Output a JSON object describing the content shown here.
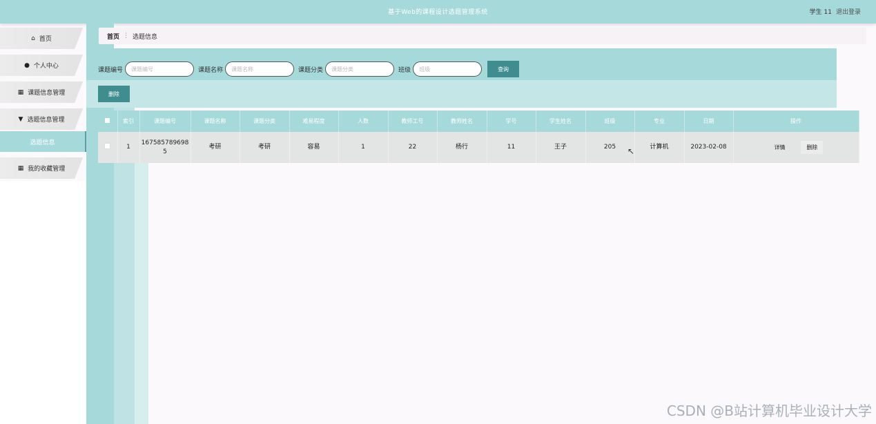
{
  "header": {
    "title": "基于Web的课程设计选题管理系统",
    "user": "学生 11",
    "logout": "退出登录"
  },
  "sidebar": {
    "items": [
      {
        "label": "首页",
        "icon": "home-icon"
      },
      {
        "label": "个人中心",
        "icon": "user-icon"
      },
      {
        "label": "课题信息管理",
        "icon": "grid-icon"
      },
      {
        "label": "选题信息管理",
        "icon": "pin-icon"
      },
      {
        "label": "选题信息",
        "active": true
      },
      {
        "label": "我的收藏管理",
        "icon": "grid-icon"
      }
    ]
  },
  "breadcrumb": {
    "home": "首页",
    "current": "选题信息"
  },
  "search": {
    "fields": [
      {
        "label": "课题编号",
        "placeholder": "课题编号",
        "value": ""
      },
      {
        "label": "课题名称",
        "placeholder": "课题名称",
        "value": ""
      },
      {
        "label": "课题分类",
        "placeholder": "课题分类",
        "value": ""
      },
      {
        "label": "班级",
        "placeholder": "班级",
        "value": ""
      }
    ],
    "query_label": "查询"
  },
  "toolbar": {
    "delete_label": "删除"
  },
  "table": {
    "headers": [
      "索引",
      "课题编号",
      "课题名称",
      "课题分类",
      "难易程度",
      "人数",
      "教师工号",
      "教师姓名",
      "学号",
      "学生姓名",
      "班级",
      "专业",
      "日期",
      "操作"
    ],
    "rows": [
      {
        "index": "1",
        "topic_no": "1675857896985",
        "topic_name": "考研",
        "category": "考研",
        "difficulty": "容易",
        "people": "1",
        "teacher_no": "22",
        "teacher_name": "杨行",
        "student_no": "11",
        "student_name": "王子",
        "class": "205",
        "major": "计算机",
        "date": "2023-02-08",
        "detail_label": "详情",
        "delete_label": "删除"
      }
    ]
  },
  "watermark": "CSDN @B站计算机毕业设计大学",
  "colors": {
    "accent": "#a6d9da",
    "button": "#3f8d8f"
  }
}
